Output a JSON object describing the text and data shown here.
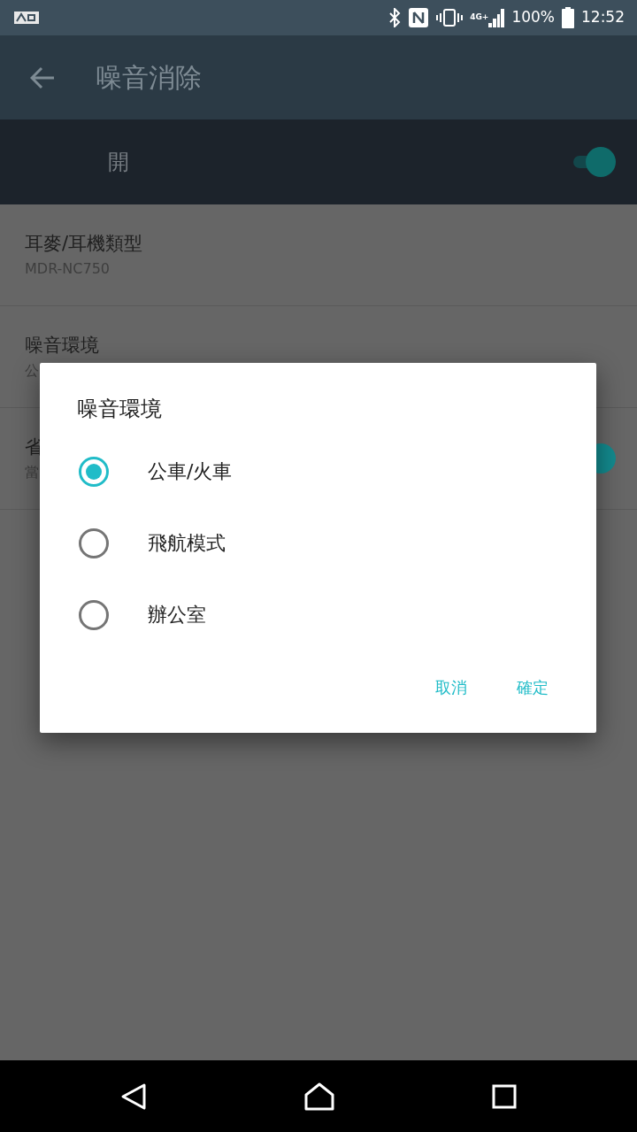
{
  "status_bar": {
    "network": "4G+",
    "battery": "100%",
    "time": "12:52"
  },
  "toolbar": {
    "title": "噪音消除"
  },
  "master_switch": {
    "label": "開",
    "on": true
  },
  "settings": [
    {
      "kind": "text",
      "title": "耳麥/耳機類型",
      "subtitle": "MDR-NC750"
    },
    {
      "kind": "text",
      "title": "噪音環境",
      "subtitle": "公"
    },
    {
      "kind": "switch",
      "title": "省",
      "subtitle": "當",
      "on": true
    }
  ],
  "dialog": {
    "title": "噪音環境",
    "options": [
      {
        "label": "公車/火車",
        "selected": true
      },
      {
        "label": "飛航模式",
        "selected": false
      },
      {
        "label": "辦公室",
        "selected": false
      }
    ],
    "buttons": [
      "取消",
      "確定"
    ]
  }
}
